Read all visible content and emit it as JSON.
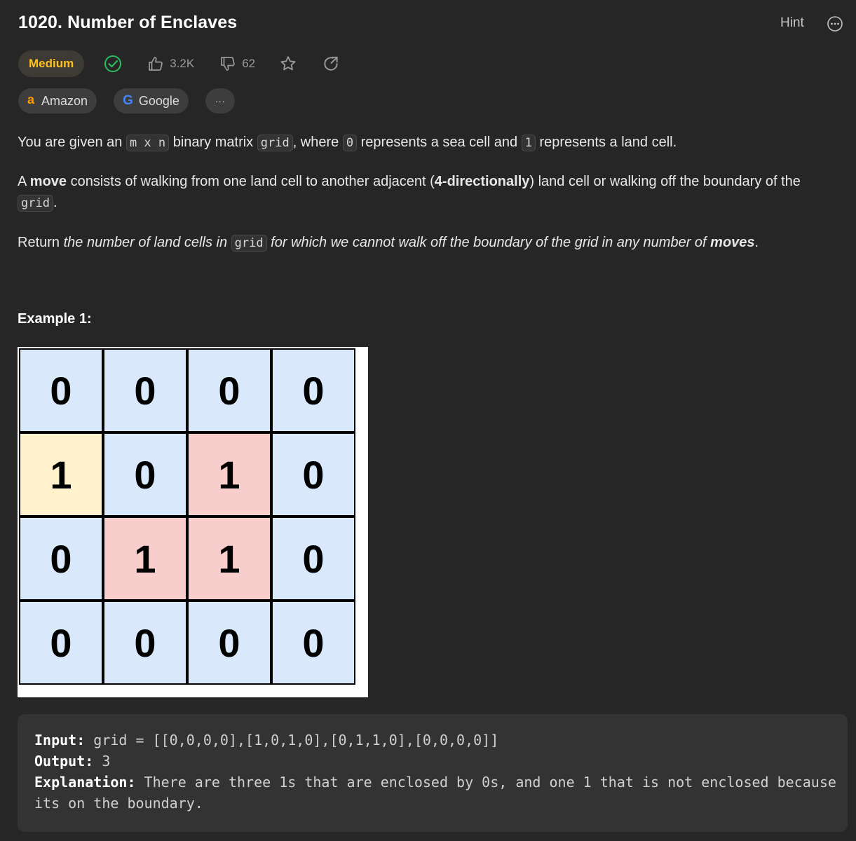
{
  "problem": {
    "title": "1020. Number of Enclaves",
    "difficulty": "Medium",
    "likes": "3.2K",
    "dislikes": "62",
    "hint_label": "Hint",
    "companies": [
      "Amazon",
      "Google"
    ],
    "more_companies": "···"
  },
  "description": {
    "p1": {
      "t1": "You are given an ",
      "c1": "m x n",
      "t2": " binary matrix ",
      "c2": "grid",
      "t3": ", where ",
      "c3": "0",
      "t4": " represents a sea cell and ",
      "c4": "1",
      "t5": " represents a land cell."
    },
    "p2": {
      "t1": "A ",
      "b1": "move",
      "t2": " consists of walking from one land cell to another adjacent (",
      "b2": "4-directionally",
      "t3": ") land cell or walking off the boundary of the ",
      "c1": "grid",
      "t4": "."
    },
    "p3": {
      "t1": "Return ",
      "i1": "the number of land cells in ",
      "c1": "grid",
      "i2": " for which we cannot walk off the boundary of the grid in any number of ",
      "b1": "moves",
      "t2": "."
    }
  },
  "example1": {
    "title": "Example 1:",
    "grid": [
      [
        "0",
        "0",
        "0",
        "0"
      ],
      [
        "1",
        "0",
        "1",
        "0"
      ],
      [
        "0",
        "1",
        "1",
        "0"
      ],
      [
        "0",
        "0",
        "0",
        "0"
      ]
    ],
    "colors": {
      "sea": "#dae8fc",
      "boundary_land": "#fff2cc",
      "enclosed_land": "#f8cecc"
    },
    "input_label": "Input:",
    "input_value": " grid = [[0,0,0,0],[1,0,1,0],[0,1,1,0],[0,0,0,0]]",
    "output_label": "Output:",
    "output_value": " 3",
    "explanation_label": "Explanation:",
    "explanation_value": " There are three 1s that are enclosed by 0s, and one 1 that is not enclosed because its on the boundary."
  }
}
